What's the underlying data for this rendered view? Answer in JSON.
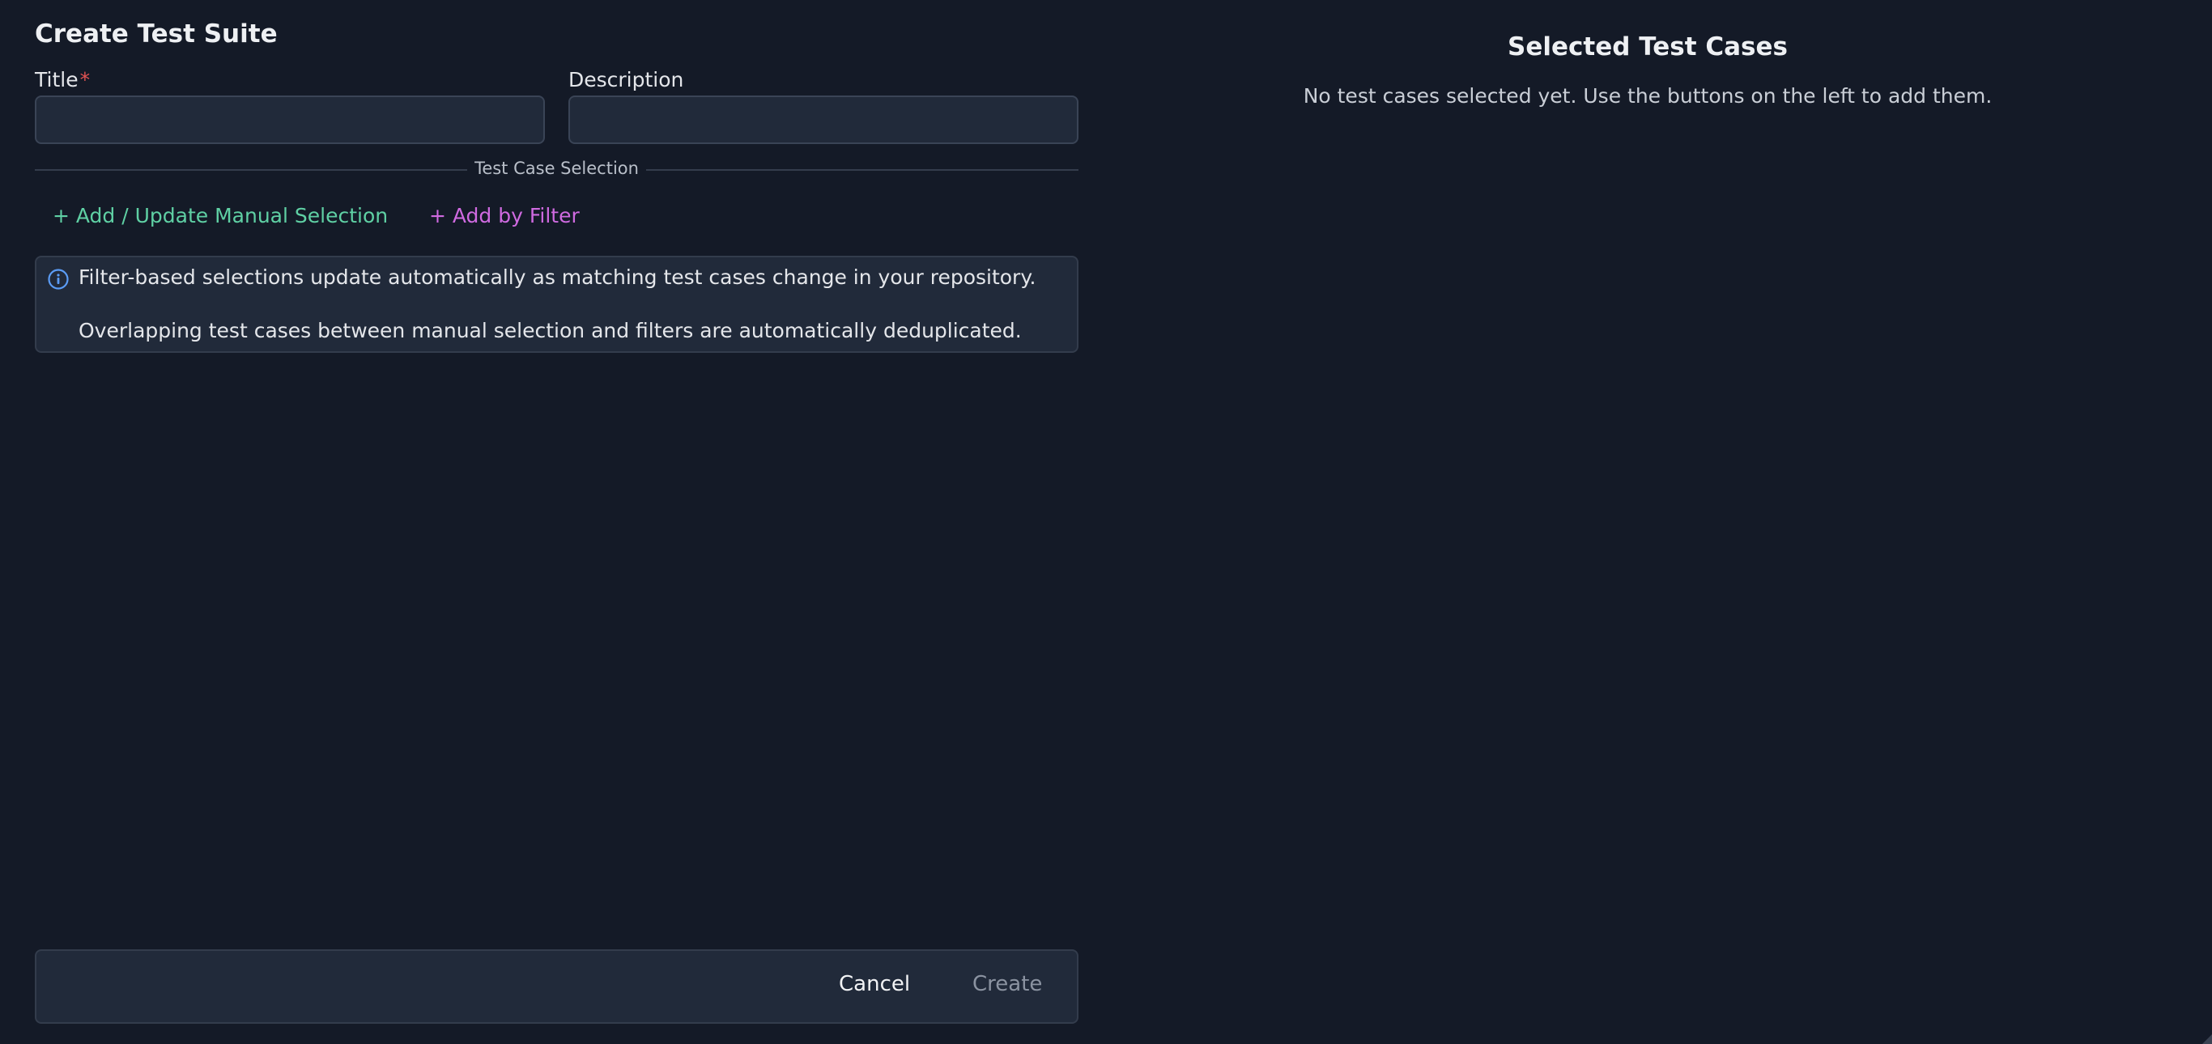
{
  "dialog": {
    "title": "Create Test Suite"
  },
  "form": {
    "title_label": "Title",
    "required_marker": "*",
    "title_value": "",
    "description_label": "Description",
    "description_value": ""
  },
  "selection": {
    "section_label": "Test Case Selection",
    "manual_button": "+ Add / Update Manual Selection",
    "filter_button": "+ Add by Filter",
    "info_icon": "info-circle-icon",
    "info_line_1": "Filter-based selections update automatically as matching test cases change in your repository.",
    "info_line_2": "Overlapping test cases between manual selection and filters are automatically deduplicated."
  },
  "footer": {
    "cancel_label": "Cancel",
    "create_label": "Create"
  },
  "selected_panel": {
    "title": "Selected Test Cases",
    "empty_message": "No test cases selected yet. Use the buttons on the left to add them."
  },
  "colors": {
    "background": "#141a27",
    "surface": "#212a3a",
    "manual_accent": "#5fd0a4",
    "filter_accent": "#cf6ae0",
    "required": "#e05252",
    "info_icon": "#5b9cf5"
  }
}
